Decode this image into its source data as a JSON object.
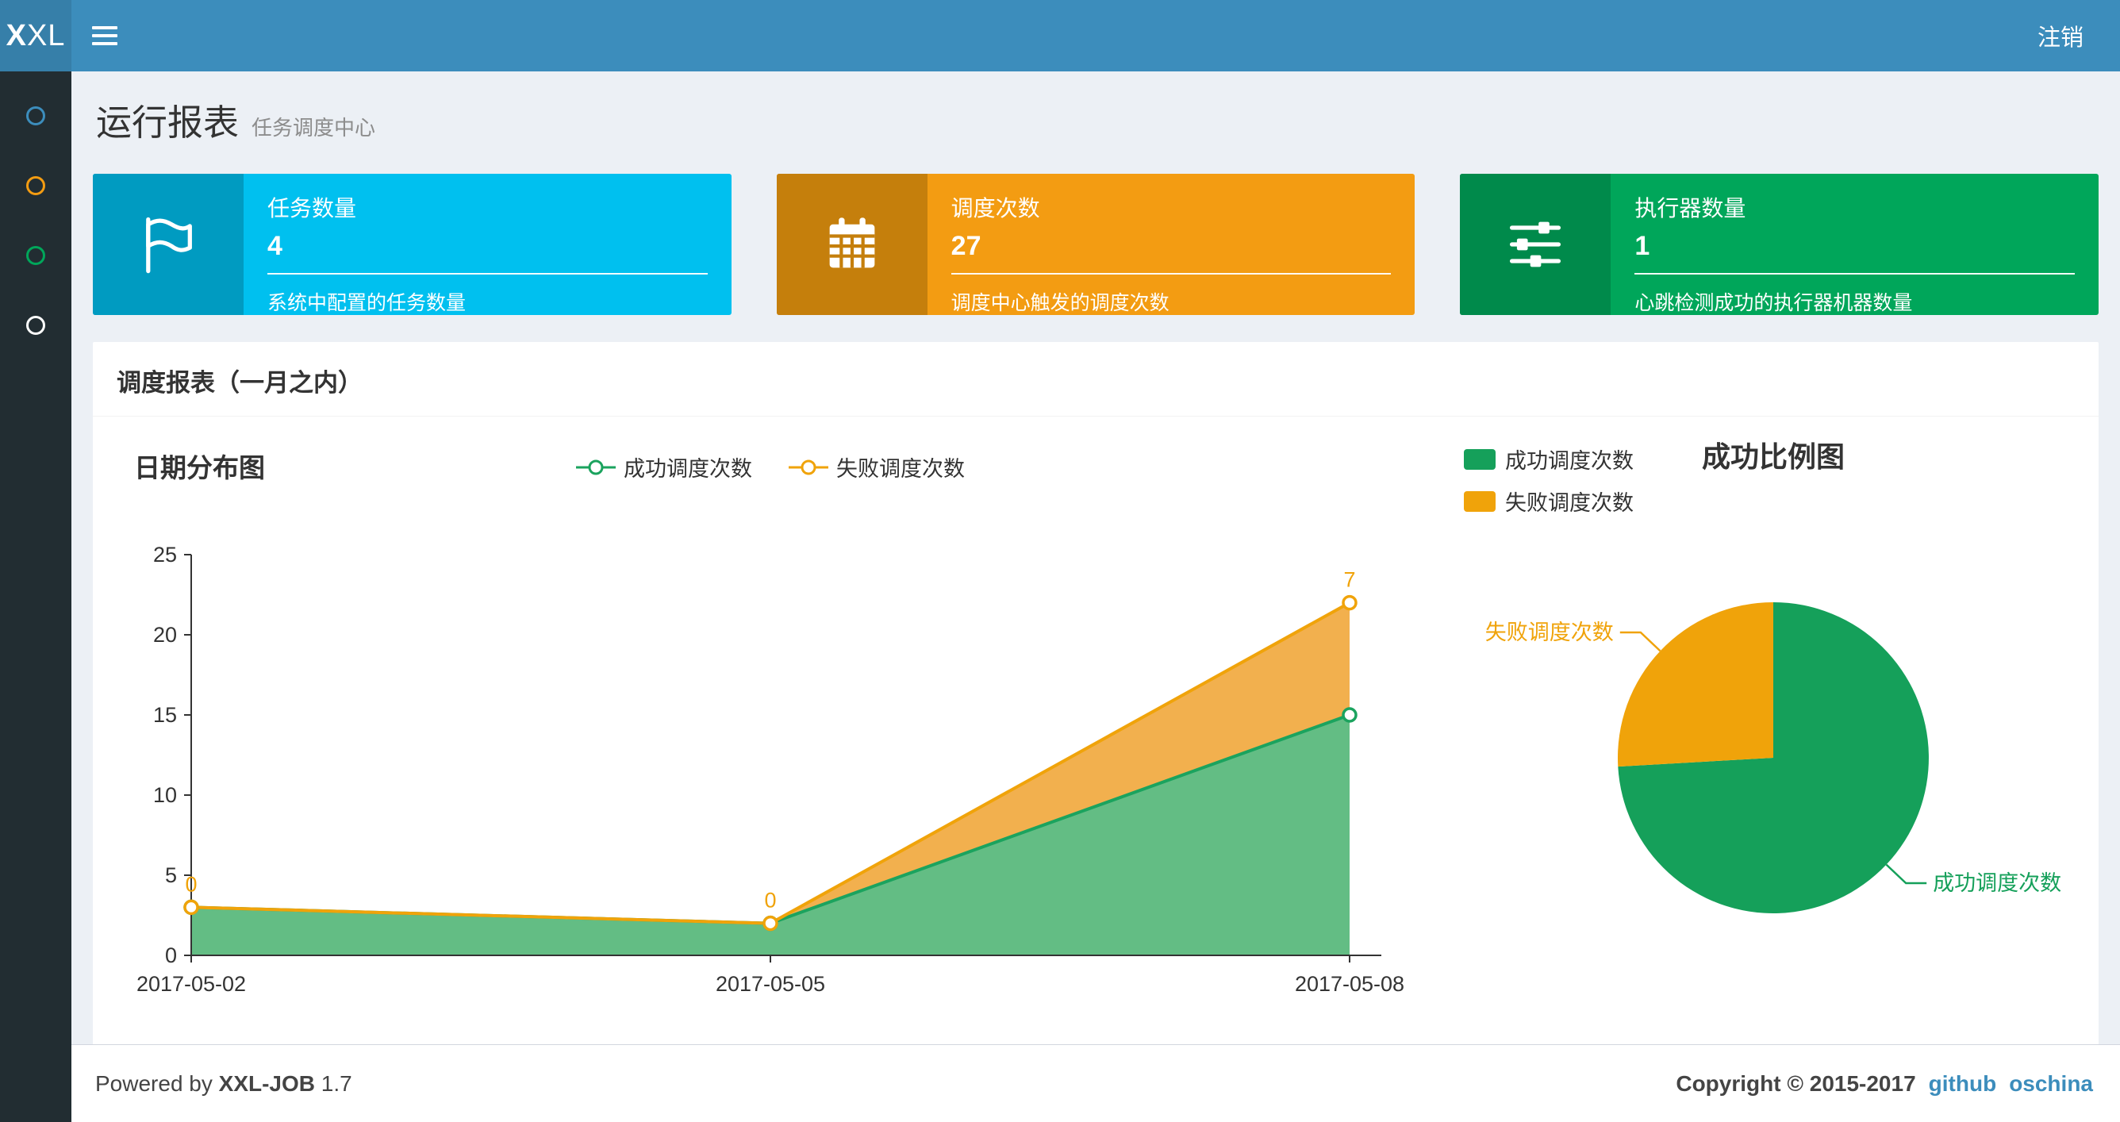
{
  "navbar": {
    "logo_bold": "X",
    "logo_rest": "XL",
    "logout_label": "注销"
  },
  "sidebar": {
    "items": [
      {
        "name": "menu-item-1",
        "color": "#3c8dbc"
      },
      {
        "name": "menu-item-2",
        "color": "#f39c12"
      },
      {
        "name": "menu-item-3",
        "color": "#00a65a"
      },
      {
        "name": "menu-item-4",
        "color": "#ffffff"
      }
    ]
  },
  "header": {
    "title": "运行报表",
    "subtitle": "任务调度中心"
  },
  "info_boxes": [
    {
      "title": "任务数量",
      "value": "4",
      "description": "系统中配置的任务数量",
      "color": "#00c0ef",
      "icon_bg": "#009bc1",
      "icon": "flag-icon"
    },
    {
      "title": "调度次数",
      "value": "27",
      "description": "调度中心触发的调度次数",
      "color": "#f39c12",
      "icon_bg": "#c57f0c",
      "icon": "calendar-icon"
    },
    {
      "title": "执行器数量",
      "value": "1",
      "description": "心跳检测成功的执行器机器数量",
      "color": "#00a65a",
      "icon_bg": "#008a4b",
      "icon": "sliders-icon"
    }
  ],
  "panel": {
    "title": "调度报表（一月之内）"
  },
  "chart_data": [
    {
      "type": "area",
      "title": "日期分布图",
      "categories": [
        "2017-05-02",
        "2017-05-05",
        "2017-05-08"
      ],
      "series": [
        {
          "name": "成功调度次数",
          "values": [
            3,
            2,
            15
          ],
          "color": "#1ba35e",
          "area_color": "#63bd84",
          "stacked": true
        },
        {
          "name": "失败调度次数",
          "values": [
            0,
            0,
            7
          ],
          "color": "#f0a30a",
          "area_color": "#f2b04e",
          "stacked": true
        }
      ],
      "ylim": [
        0,
        25
      ],
      "ytick_step": 5,
      "legend_position": "top-center",
      "value_labels_on": "失败调度次数",
      "grid": false
    },
    {
      "type": "pie",
      "title": "成功比例图",
      "slices": [
        {
          "label": "成功调度次数",
          "value": 20,
          "percent": 74.1,
          "color": "#15a05a"
        },
        {
          "label": "失败调度次数",
          "value": 7,
          "percent": 25.9,
          "color": "#f0a30a"
        }
      ],
      "legend_position": "top-left"
    }
  ],
  "footer": {
    "powered_prefix": "Powered by",
    "product": "XXL-JOB",
    "version": "1.7",
    "copyright": "Copyright © 2015-2017",
    "links": [
      {
        "label": "github"
      },
      {
        "label": "oschina"
      }
    ]
  }
}
